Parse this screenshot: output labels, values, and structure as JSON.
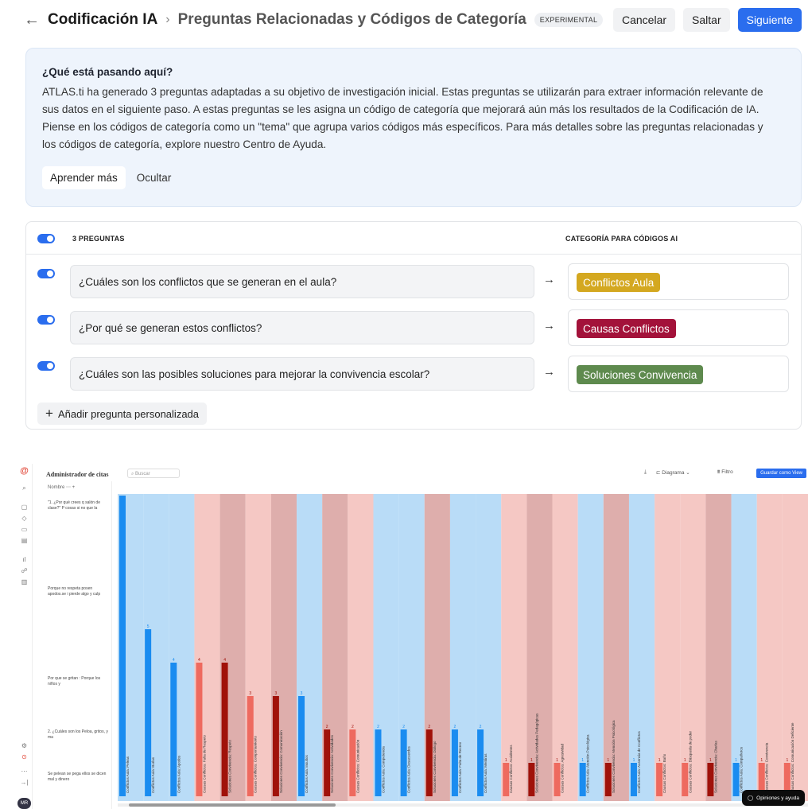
{
  "header": {
    "title": "Codificación IA",
    "subtitle": "Preguntas Relacionadas y Códigos de Categoría",
    "badge": "EXPERIMENTAL",
    "cancel": "Cancelar",
    "skip": "Saltar",
    "next": "Siguiente"
  },
  "info": {
    "heading": "¿Qué está pasando aquí?",
    "line1": "ATLAS.ti ha generado 3 preguntas adaptadas a su objetivo de investigación inicial. Estas preguntas se utilizarán para extraer información relevante de",
    "line2": "sus datos en el siguiente paso. A estas preguntas se les asigna un código de categoría que mejorará aún más los resultados de la Codificación de IA.",
    "line3": "Piense en los códigos de categoría como un \"tema\" que agrupa varios códigos más específicos. Para más detalles sobre las preguntas relacionadas y",
    "line4": "los códigos de categoría, explore nuestro Centro de Ayuda.",
    "learn_more": "Aprender más",
    "hide": "Ocultar"
  },
  "questions": {
    "count_header": "3 PREGUNTAS",
    "category_header": "CATEGORÍA PARA CÓDIGOS AI",
    "items": [
      {
        "text": "¿Cuáles son los conflictos que se generan en el aula?",
        "category": "Conflictos Aula",
        "color": "#d4a820"
      },
      {
        "text": "¿Por qué se generan estos conflictos?",
        "category": "Causas Conflictos",
        "color": "#a3123a"
      },
      {
        "text": "¿Cuáles son las posibles soluciones para mejorar la convivencia escolar?",
        "category": "Soluciones Convivencia",
        "color": "#5e8a4e"
      }
    ],
    "add_custom": "Añadir pregunta personalizada"
  },
  "quotation_manager": {
    "title": "Administrador de citas",
    "search_placeholder": "Buscar",
    "diagram": "Diagrama",
    "filter": "Filtro",
    "save_view": "Guardar como View",
    "name_header": "Nombre",
    "feedback": "Opiniones y ayuda",
    "avatar": "MR",
    "rows": [
      "\"1. ¿Por qué crees q salón de clase?\" P cosas si no que la",
      "Porque no respeta posen apodos.se i pierde algo y culp",
      "Por que se gritan : Porque los niños y",
      "2. ¿Cuáles son los Peloa, gritos, y ma",
      "Se pelean se pega ellos se dicen mal y dinero"
    ]
  },
  "chart_data": {
    "type": "bar",
    "ylim": [
      0,
      9
    ],
    "colors": {
      "blue": "#1a8cf0",
      "salmon": "#ee6a5f",
      "darkred": "#a0120a",
      "bg_blue": "#b9dcf7",
      "bg_pink": "#f5c8c4",
      "bg_rose": "#deaeac"
    },
    "categories": [
      {
        "label": "Conflictos Aula: Peleas",
        "value": 9,
        "group": "blue"
      },
      {
        "label": "Conflictos Aula: Burlas",
        "value": 5,
        "group": "blue"
      },
      {
        "label": "Conflictos Aula: Apodos",
        "value": 4,
        "group": "blue"
      },
      {
        "label": "Causas Conflictos: Falta de Respeto",
        "value": 4,
        "group": "salmon"
      },
      {
        "label": "Soluciones Convivencia: Respeto",
        "value": 4,
        "group": "darkred"
      },
      {
        "label": "Causas Conflictos: Comportamiento",
        "value": 3,
        "group": "salmon"
      },
      {
        "label": "Soluciones Convivencia: Comunicación",
        "value": 3,
        "group": "darkred"
      },
      {
        "label": "Conflictos Aula: Insultos",
        "value": 3,
        "group": "blue"
      },
      {
        "label": "Soluciones Convivencia: Actividades",
        "value": 2,
        "group": "darkred"
      },
      {
        "label": "Causas Conflictos: Comunicación",
        "value": 2,
        "group": "salmon"
      },
      {
        "label": "Conflictos Aula: Competencia",
        "value": 2,
        "group": "blue"
      },
      {
        "label": "Conflictos Aula: Desacuerdos",
        "value": 2,
        "group": "blue"
      },
      {
        "label": "Soluciones Convivencia: Diálogo",
        "value": 2,
        "group": "darkred"
      },
      {
        "label": "Conflictos Aula: Falta de Recreo",
        "value": 2,
        "group": "blue"
      },
      {
        "label": "Conflictos Aula: Mentiras",
        "value": 2,
        "group": "blue"
      },
      {
        "label": "Causas Conflictos: Accidentes",
        "value": 1,
        "group": "salmon"
      },
      {
        "label": "Soluciones Convivencia: Actividades Pedagógicas",
        "value": 1,
        "group": "darkred"
      },
      {
        "label": "Causas Conflictos: Agresividad",
        "value": 1,
        "group": "salmon"
      },
      {
        "label": "Conflictos Aula: Atención Psicológica",
        "value": 1,
        "group": "blue"
      },
      {
        "label": "Soluciones Convivencia: Atención Psicológica",
        "value": 1,
        "group": "darkred"
      },
      {
        "label": "Conflictos Aula: Ausencia de Conflictos",
        "value": 1,
        "group": "blue"
      },
      {
        "label": "Causas Conflictos: Baño",
        "value": 1,
        "group": "salmon"
      },
      {
        "label": "Causas Conflictos: Búsqueda de poder",
        "value": 1,
        "group": "salmon"
      },
      {
        "label": "Soluciones Convivencia: Charlas",
        "value": 1,
        "group": "darkred"
      },
      {
        "label": "Conflictos Aula: Compañeros",
        "value": 1,
        "group": "blue"
      },
      {
        "label": "Causas Conflictos: Convivencia",
        "value": 1,
        "group": "salmon"
      },
      {
        "label": "Causas Conflictos: Comunicación Deficiente",
        "value": 1,
        "group": "salmon"
      }
    ]
  }
}
